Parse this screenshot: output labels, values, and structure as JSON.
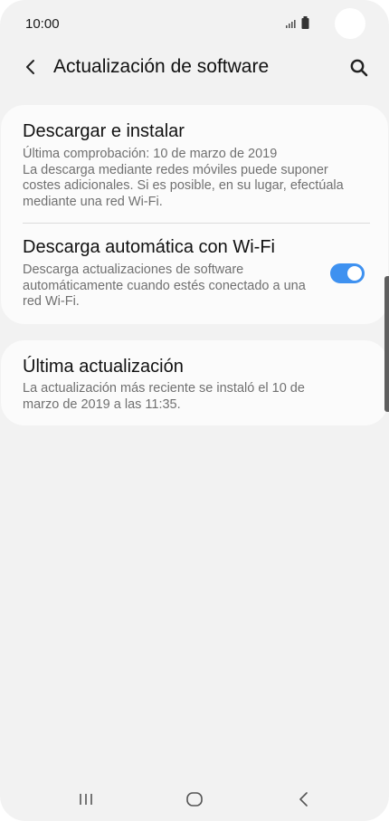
{
  "status_bar": {
    "time": "10:00",
    "icons": [
      "signal-icon",
      "battery-icon"
    ]
  },
  "app_bar": {
    "title": "Actualización de software",
    "back_icon": "chevron-left-icon",
    "search_icon": "search-icon"
  },
  "settings": {
    "download_install": {
      "title": "Descargar e instalar",
      "subtitle": "Última comprobación: 10 de marzo de 2019\nLa descarga mediante redes móviles puede suponer costes adicionales. Si es posible, en su lugar, efectúala mediante una red Wi-Fi."
    },
    "auto_download": {
      "title": "Descarga automática con Wi-Fi",
      "subtitle": "Descarga actualizaciones de software automáticamente cuando estés conectado a una red Wi-Fi.",
      "enabled": true
    },
    "last_update": {
      "title": "Última actualización",
      "subtitle": "La actualización más reciente se instaló el 10 de marzo de 2019 a las 11:35."
    }
  },
  "nav_bar": {
    "buttons": [
      "recent-apps-icon",
      "home-icon",
      "back-icon"
    ]
  },
  "colors": {
    "accent": "#3e91f0",
    "background": "#f2f2f2",
    "card": "#fbfbfb"
  }
}
